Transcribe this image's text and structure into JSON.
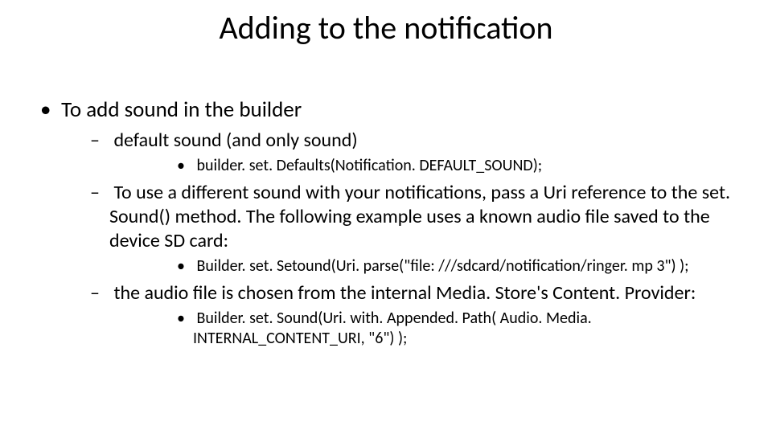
{
  "title": "Adding to the notification",
  "bullets": {
    "l1_0": "To add sound in the builder",
    "l2_0": "default sound  (and only sound)",
    "l3_0": "builder. set. Defaults(Notification. DEFAULT_SOUND);",
    "l2_1": "To use a different sound with your notifications, pass a Uri reference to the set. Sound() method. The following example uses a known audio file saved to the device SD card:",
    "l3_1": "Builder. set. Setound(Uri. parse(\"file: ///sdcard/notification/ringer. mp 3\") );",
    "l2_2": "the audio file is chosen from the internal Media. Store's Content. Provider:",
    "l3_2": "Builder. set. Sound(Uri. with. Appended. Path( Audio. Media. INTERNAL_CONTENT_URI, \"6\") );"
  }
}
